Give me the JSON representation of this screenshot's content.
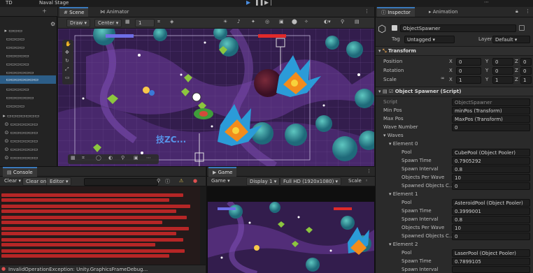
{
  "topbar": {
    "left_label": "TD",
    "title": "Naval Stage"
  },
  "scene_tabs": {
    "scene": "Scene",
    "animator": "Animator"
  },
  "scene_toolbar": {
    "shading": "Draw",
    "mode": "Center",
    "number": "1"
  },
  "inspector_tabs": {
    "inspector": "Inspector",
    "animation": "Animation"
  },
  "inspector": {
    "object_name": "ObjectSpawner",
    "tag_label": "Tag",
    "tag_value": "Untagged",
    "layer_label": "Layer",
    "layer_value": "Default",
    "transform": {
      "title": "Transform",
      "position": {
        "label": "Position",
        "x": "0",
        "y": "0",
        "z": "0"
      },
      "rotation": {
        "label": "Rotation",
        "x": "0",
        "y": "0",
        "z": "0"
      },
      "scale": {
        "label": "Scale",
        "x": "1",
        "y": "1",
        "z": "1"
      }
    },
    "script_component": {
      "title": "Object Spawner (Script)",
      "script_label": "Script",
      "script_value": "ObjectSpawner",
      "min_pos_label": "Min Pos",
      "min_pos_value": "minPos (Transform)",
      "max_pos_label": "Max Pos",
      "max_pos_value": "MaxPos (Transform)",
      "wave_number_label": "Wave Number",
      "wave_number_value": "0",
      "waves_label": "Waves"
    },
    "elements": [
      {
        "title": "Element 0",
        "rows": [
          {
            "label": "Pool",
            "value": "CubePool (Object Pooler)"
          },
          {
            "label": "Spawn Time",
            "value": "0.7905292"
          },
          {
            "label": "Spawn Interval",
            "value": "0.8"
          },
          {
            "label": "Objects Per Wave",
            "value": "10"
          },
          {
            "label": "Spawned Objects C...",
            "value": "0"
          }
        ]
      },
      {
        "title": "Element 1",
        "rows": [
          {
            "label": "Pool",
            "value": "AsteroidPool (Object Pooler)"
          },
          {
            "label": "Spawn Time",
            "value": "0.3999001"
          },
          {
            "label": "Spawn Interval",
            "value": "0.8"
          },
          {
            "label": "Objects Per Wave",
            "value": "10"
          },
          {
            "label": "Spawned Objects C...",
            "value": "0"
          }
        ]
      },
      {
        "title": "Element 2",
        "rows": [
          {
            "label": "Pool",
            "value": "LaserPool (Object Pooler)"
          },
          {
            "label": "Spawn Time",
            "value": "0.7899105"
          },
          {
            "label": "Spawn Interval",
            "value": ""
          }
        ]
      }
    ]
  },
  "console": {
    "tab": "Console",
    "buttons": {
      "clear": "Clear",
      "collapse": "Clear on Build",
      "error_pause": "Editor"
    },
    "bottom_line": "InvalidOperationException: Unity.GraphicsFrameDebug..."
  },
  "game": {
    "tab": "Game",
    "display": "Display 1",
    "resolution": "Full HD (1920x1080)",
    "scale_label": "Scale",
    "stat_label": "Game"
  },
  "watermark": "技ZC...",
  "colors": {
    "accent": "#3a79bb",
    "selection": "#2c5d87",
    "error_red": "#c62828",
    "space_bg": "#3a2255",
    "health_blue": "#6e6ee6",
    "health_red": "#e02a2a"
  }
}
